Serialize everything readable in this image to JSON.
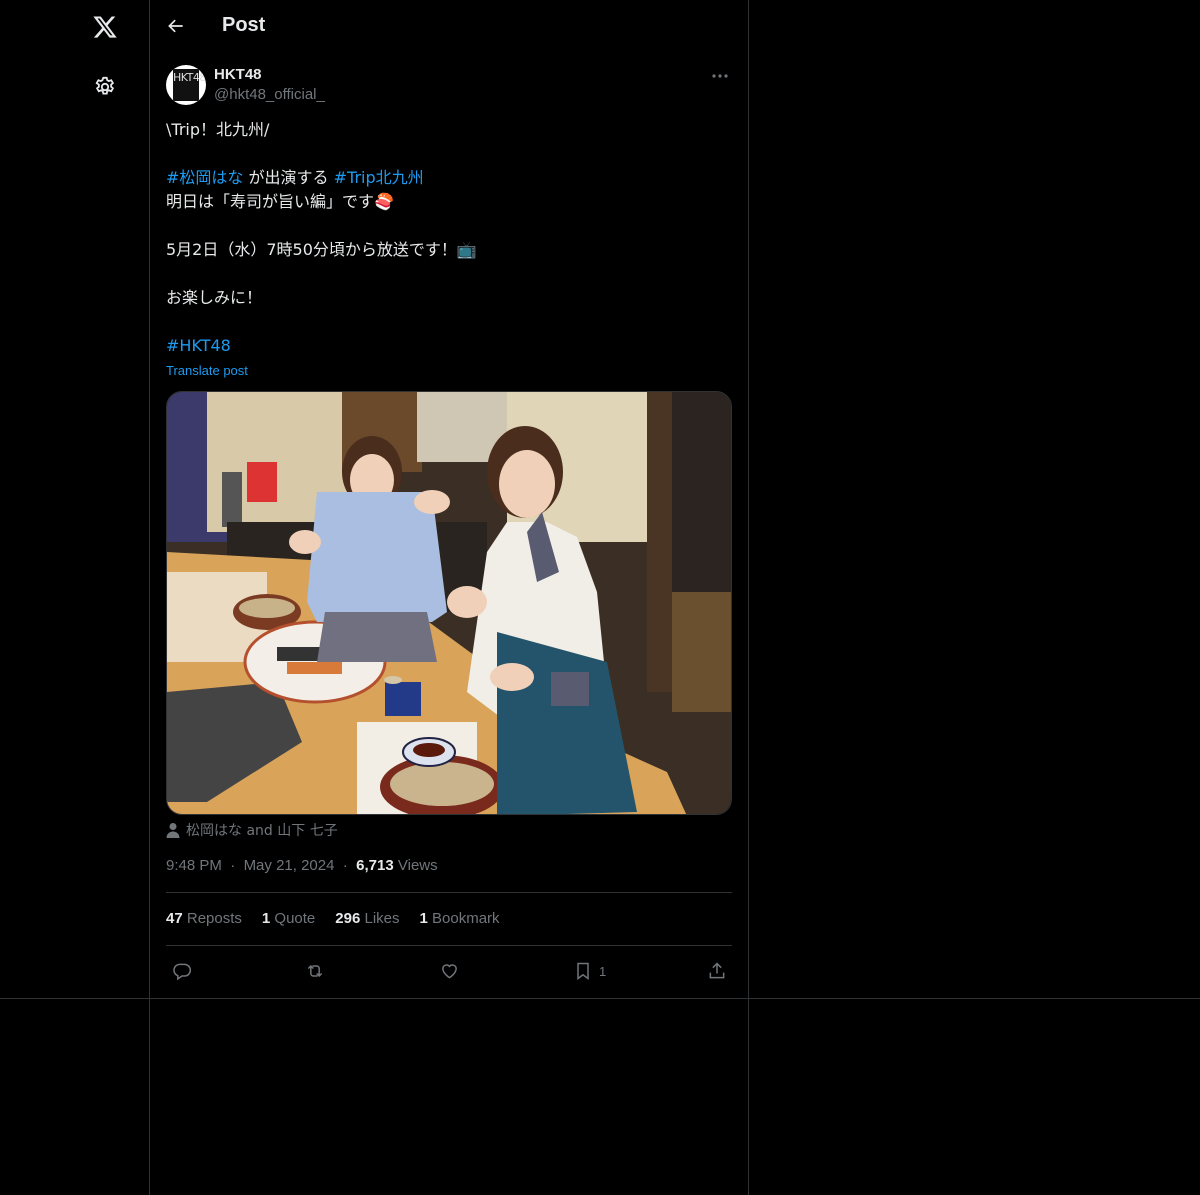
{
  "header": {
    "title": "Post"
  },
  "author": {
    "name": "HKT48",
    "handle": "@hkt48_official_",
    "avatar_text": "HKT48"
  },
  "post": {
    "lines": [
      {
        "type": "text",
        "text": "\\Trip！北九州/"
      },
      {
        "type": "gap"
      },
      {
        "type": "rich",
        "parts": [
          {
            "text": "#松岡はな",
            "tag": true
          },
          {
            "text": " が出演する ",
            "tag": false
          },
          {
            "text": "#Trip北九州",
            "tag": true
          }
        ]
      },
      {
        "type": "rich",
        "parts": [
          {
            "text": "明日は「寿司が旨い編」です",
            "tag": false
          },
          {
            "text": "🍣",
            "tag": false
          }
        ]
      },
      {
        "type": "gap"
      },
      {
        "type": "rich",
        "parts": [
          {
            "text": "5月2日（水）7時50分頃から放送です！",
            "tag": false
          },
          {
            "text": "📺",
            "tag": false
          }
        ]
      },
      {
        "type": "gap"
      },
      {
        "type": "text",
        "text": "お楽しみに！"
      },
      {
        "type": "gap"
      },
      {
        "type": "rich",
        "parts": [
          {
            "text": "#HKT48",
            "tag": true
          }
        ]
      }
    ],
    "translate_label": "Translate post",
    "tagged_people": "松岡はな and 山下 七子",
    "time": "9:48 PM",
    "date": "May 21, 2024",
    "views_count": "6,713",
    "views_label": "Views"
  },
  "stats": [
    {
      "count": "47",
      "label": "Reposts"
    },
    {
      "count": "1",
      "label": "Quote"
    },
    {
      "count": "296",
      "label": "Likes"
    },
    {
      "count": "1",
      "label": "Bookmark"
    }
  ],
  "actions": {
    "bookmark_count": "1"
  },
  "colors": {
    "background": "#000000",
    "accent": "#1d9bf0",
    "muted": "#71767b",
    "border": "#2f3336",
    "text": "#e7e9ea"
  },
  "icons": [
    "x-logo-icon",
    "gear-icon",
    "back-arrow-icon",
    "more-icon",
    "person-icon",
    "reply-icon",
    "repost-icon",
    "like-icon",
    "bookmark-icon",
    "share-icon"
  ]
}
